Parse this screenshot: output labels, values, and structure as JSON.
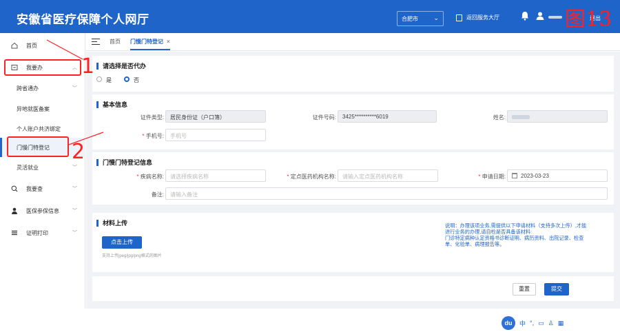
{
  "header": {
    "title": "安徽省医疗保障个人网厅",
    "city": "合肥市",
    "back_link": "返回服务大厅",
    "logout": "退出"
  },
  "annotations": {
    "figure_tag": "图13",
    "step1": "1",
    "step2": "2"
  },
  "sidebar": {
    "items": [
      {
        "label": "首页",
        "icon": "home-icon"
      },
      {
        "label": "我要办",
        "icon": "handle-icon"
      },
      {
        "label": "跨省通办"
      },
      {
        "label": "异地就医备案"
      },
      {
        "label": "个人账户共济绑定"
      },
      {
        "label": "门慢门特登记"
      },
      {
        "label": "灵活就业"
      },
      {
        "label": "我要查",
        "icon": "search-icon"
      },
      {
        "label": "医保参保信息",
        "icon": "user-icon"
      },
      {
        "label": "证明打印",
        "icon": "list-icon"
      }
    ]
  },
  "tabs": {
    "home": "首页",
    "active": "门慢门特登记",
    "close": "×"
  },
  "agent_section": {
    "title": "请选择是否代办",
    "options": [
      "是",
      "否"
    ],
    "selected": "否"
  },
  "basic_info": {
    "title": "基本信息",
    "id_type_label": "证件类型:",
    "id_type_value": "居民身份证（户口簿）",
    "id_no_label": "证件号码:",
    "id_no_value": "3425**********6019",
    "name_label": "姓名:",
    "phone_label": "手机号:",
    "phone_placeholder": "手机号"
  },
  "registration": {
    "title": "门慢门特登记信息",
    "disease_label": "疾病名称:",
    "disease_placeholder": "请选择疾病名称",
    "org_label": "定点医药机构名称:",
    "org_placeholder": "请输入定点医药机构名称",
    "date_label": "申请日期:",
    "date_value": "2023-03-23",
    "remark_label": "备注:",
    "remark_placeholder": "请输入备注"
  },
  "upload": {
    "title": "材料上传",
    "button": "点击上传",
    "hint": "支持上传jpeg/jpg/png格式的图片",
    "note_line1": "说明：办理该项业务,需提供以下申请材料（支持多次上传）,才能",
    "note_line2": "进行业务的办理,请自检是否具备该材料:",
    "note_line3": "门诊特定病种认定资格书诊断证明、病历资料、出院记录、检查",
    "note_line4": "单、化验单、病理报告等。"
  },
  "actions": {
    "reset": "重置",
    "submit": "提交"
  },
  "ime": {
    "badge": "du",
    "lang": "中"
  },
  "colors": {
    "primary": "#1f64c8",
    "annotation": "#ff2020"
  }
}
